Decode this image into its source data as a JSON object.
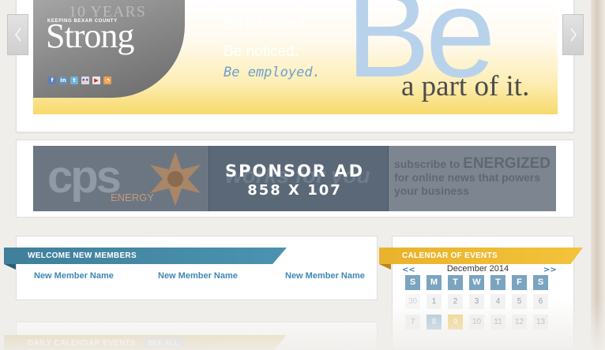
{
  "hero": {
    "years": "10 YEARS",
    "county_line": "KEEPING BEXAR COUNTY",
    "brand": "Strong",
    "taglines": [
      "Be informed.",
      "Be noticed.",
      "Be employed."
    ],
    "big_word": "Be",
    "sub_line": "a part of it.",
    "social_icons": [
      "facebook-icon",
      "linkedin-icon",
      "twitter-icon",
      "flickr-icon",
      "youtube-icon",
      "rss-icon"
    ],
    "colors": {
      "tagline_accent": "#6d9fd0",
      "big_word": "#b9d2ec"
    }
  },
  "carousel": {
    "prev_icon": "chevron-left-icon",
    "next_icon": "chevron-right-icon"
  },
  "sponsor": {
    "brand": "cps",
    "brand_sub": "ENERGY",
    "mid_text": "works for you",
    "subscribe_pre": "subscribe to",
    "subscribe_brand": "ENERGIZED",
    "subscribe_rest": "for online news that powers your business",
    "overlay_title": "SPONSOR AD",
    "overlay_size": "858 X 107"
  },
  "welcome": {
    "title": "WELCOME NEW MEMBERS",
    "members": [
      "New Member Name",
      "New Member Name",
      "New Member Name"
    ],
    "color": "#4b93b1"
  },
  "calendar": {
    "title": "CALENDAR OF EVENTS",
    "prev": "<<",
    "next": ">>",
    "month": "December 2014",
    "weekdays": [
      "S",
      "M",
      "T",
      "W",
      "T",
      "F",
      "S"
    ],
    "week1": [
      "30",
      "1",
      "2",
      "3",
      "4",
      "5",
      "6"
    ],
    "week2": [
      "7",
      "8",
      "9",
      "10",
      "11",
      "12",
      "13"
    ],
    "color": "#f2c33b"
  },
  "bottom": {
    "title": "DAILY CALENDAR EVENTS",
    "badge": "SEE ALL"
  }
}
